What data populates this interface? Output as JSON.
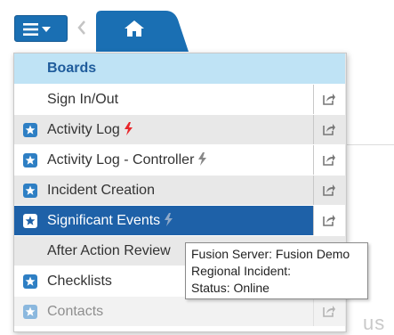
{
  "topbar": {
    "menu_button": "hamburger-dropdown",
    "back": "chevron-left",
    "home_tab": "home"
  },
  "menu": {
    "header": "Boards",
    "items": [
      {
        "label": "Sign In/Out",
        "star": false,
        "bolt": "",
        "action": true
      },
      {
        "label": "Activity Log",
        "star": true,
        "bolt": "red",
        "action": true
      },
      {
        "label": "Activity Log - Controller",
        "star": true,
        "bolt": "gray",
        "action": true
      },
      {
        "label": "Incident Creation",
        "star": true,
        "bolt": "",
        "action": true
      },
      {
        "label": "Significant Events",
        "star": true,
        "bolt": "light",
        "action": true,
        "selected": true
      },
      {
        "label": "After Action Review",
        "star": false,
        "bolt": "",
        "action": false
      },
      {
        "label": "Checklists",
        "star": true,
        "bolt": "",
        "action": false
      },
      {
        "label": "Contacts",
        "star": true,
        "bolt": "",
        "action": true
      }
    ]
  },
  "tooltip": {
    "line1": "Fusion Server:  Fusion Demo",
    "line2": "Regional Incident:",
    "line3": "Status:  Online"
  },
  "background": {
    "partial_text": "us"
  },
  "colors": {
    "primary": "#1a6fb3",
    "selected": "#1e61a8",
    "header": "#bfe3f5",
    "bolt_red": "#e8262a"
  }
}
